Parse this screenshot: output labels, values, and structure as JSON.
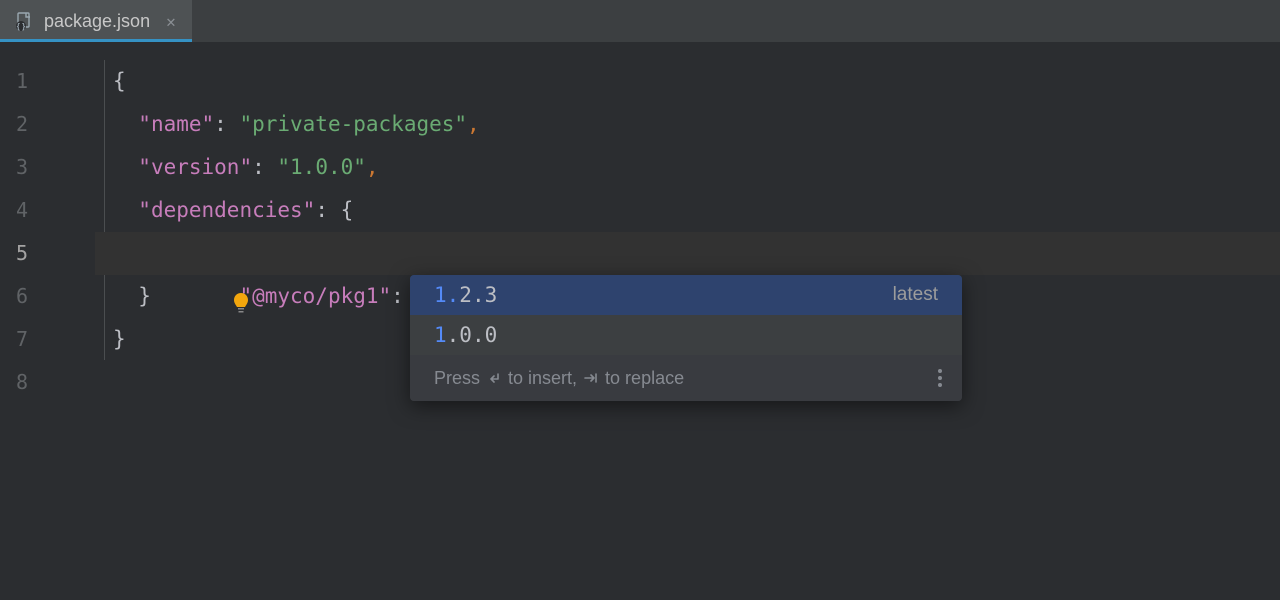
{
  "tab": {
    "label": "package.json"
  },
  "code": {
    "line1": "{",
    "line2_key": "\"name\"",
    "line2_value": "\"private-packages\"",
    "line3_key": "\"version\"",
    "line3_value": "\"1.0.0\"",
    "line4_key": "\"dependencies\"",
    "line4_brace": "{",
    "line5_key": "\"@myco/pkg1\"",
    "line5_value": "\"1.\"",
    "line6": "}",
    "line7": "}"
  },
  "line_numbers": [
    "1",
    "2",
    "3",
    "4",
    "5",
    "6",
    "7",
    "8"
  ],
  "autocomplete": {
    "items": [
      {
        "match": "1.",
        "rest": "2.3",
        "tag": "latest"
      },
      {
        "match": "1",
        "rest": ".0.0",
        "tag": ""
      }
    ],
    "footer_press": "Press ",
    "footer_insert": " to insert, ",
    "footer_replace": " to replace"
  }
}
